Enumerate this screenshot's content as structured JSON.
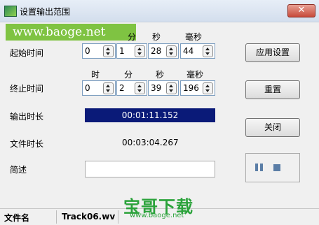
{
  "window": {
    "title": "设置输出范围",
    "close_symbol": "✕"
  },
  "watermark": {
    "text": "www.baoge.net"
  },
  "columns": {
    "hour": "时",
    "minute": "分",
    "second": "秒",
    "millisecond": "毫秒"
  },
  "start": {
    "label": "起始时间",
    "hour": "0",
    "minute": "1",
    "second": "28",
    "millisecond": "44"
  },
  "end": {
    "label": "终止时间",
    "hour": "0",
    "minute": "2",
    "second": "39",
    "millisecond": "196"
  },
  "output_duration": {
    "label": "输出时长",
    "value": "00:01:11.152"
  },
  "file_duration": {
    "label": "文件时长",
    "value": "00:03:04.267"
  },
  "description": {
    "label": "简述",
    "value": ""
  },
  "buttons": {
    "apply": "应用设置",
    "reset": "重置",
    "close": "关闭"
  },
  "player": {
    "pause_icon": "pause-icon",
    "stop_icon": "stop-icon"
  },
  "status": {
    "file_label": "文件名",
    "file_name": "Track06.wv"
  },
  "logo": {
    "text": "宝哥下载",
    "url": "www.baoge.net"
  }
}
